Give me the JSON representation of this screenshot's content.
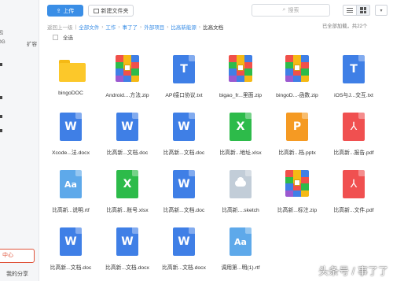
{
  "sidebar": {
    "left_a": "云",
    "left_b": "0G",
    "expand_label": "扩容",
    "center_label": "中心",
    "share_label": "我的分享"
  },
  "toolbar": {
    "upload_label": "上传",
    "new_folder_label": "新建文件夹",
    "search_placeholder": "搜索"
  },
  "breadcrumb": {
    "back": "返回上一级",
    "items": [
      "全部文件",
      "工作",
      "事了了",
      "外部项目",
      "比高新能源"
    ],
    "current": "比高文档",
    "loaded_status": "已全部加载，共22个"
  },
  "select_all_label": "全选",
  "files": [
    {
      "name": "bingoDOC",
      "type": "folder",
      "icon": "folder-icon"
    },
    {
      "name": "Android....方法.zip",
      "type": "zip",
      "icon": "zip-icon"
    },
    {
      "name": "API接口协议.txt",
      "type": "txt",
      "icon": "txt-icon",
      "letter": "T"
    },
    {
      "name": "bigao_fr...里面.zip",
      "type": "zip",
      "icon": "zip-icon"
    },
    {
      "name": "bingoD...-函数.zip",
      "type": "zip",
      "icon": "zip-icon"
    },
    {
      "name": "iOS与J...交互.txt",
      "type": "txt",
      "icon": "txt-icon",
      "letter": "T"
    },
    {
      "name": "Xcode...法.docx",
      "type": "word",
      "icon": "word-icon",
      "letter": "W"
    },
    {
      "name": "比高新...文档.doc",
      "type": "word",
      "icon": "word-icon",
      "letter": "W"
    },
    {
      "name": "比高新...文档.doc",
      "type": "word",
      "icon": "word-icon",
      "letter": "W"
    },
    {
      "name": "比高新...地址.xlsx",
      "type": "excel",
      "icon": "excel-icon",
      "letter": "X"
    },
    {
      "name": "比高新...档.pptx",
      "type": "ppt",
      "icon": "ppt-icon",
      "letter": "P"
    },
    {
      "name": "比高新...报告.pdf",
      "type": "pdf",
      "icon": "pdf-icon"
    },
    {
      "name": "比高新...说明.rtf",
      "type": "rtf",
      "icon": "rtf-icon",
      "letter": "Aa"
    },
    {
      "name": "比高新...账号.xlsx",
      "type": "excel",
      "icon": "excel-icon",
      "letter": "X"
    },
    {
      "name": "比高新...文档.doc",
      "type": "word",
      "icon": "word-icon",
      "letter": "W"
    },
    {
      "name": "比高新....sketch",
      "type": "sketch",
      "icon": "sketch-icon"
    },
    {
      "name": "比高新...标注.zip",
      "type": "zip",
      "icon": "zip-icon"
    },
    {
      "name": "比高新...文件.pdf",
      "type": "pdf",
      "icon": "pdf-icon"
    },
    {
      "name": "比高新...文档.doc",
      "type": "word",
      "icon": "word-icon",
      "letter": "W"
    },
    {
      "name": "比高新...文档.docx",
      "type": "word",
      "icon": "word-icon",
      "letter": "W"
    },
    {
      "name": "比高新...文档.docx",
      "type": "word",
      "icon": "word-icon",
      "letter": "W"
    },
    {
      "name": "调用第...明(1).rtf",
      "type": "rtf",
      "icon": "rtf-icon",
      "letter": "Aa"
    }
  ],
  "watermark": "头条号 / 事了了"
}
